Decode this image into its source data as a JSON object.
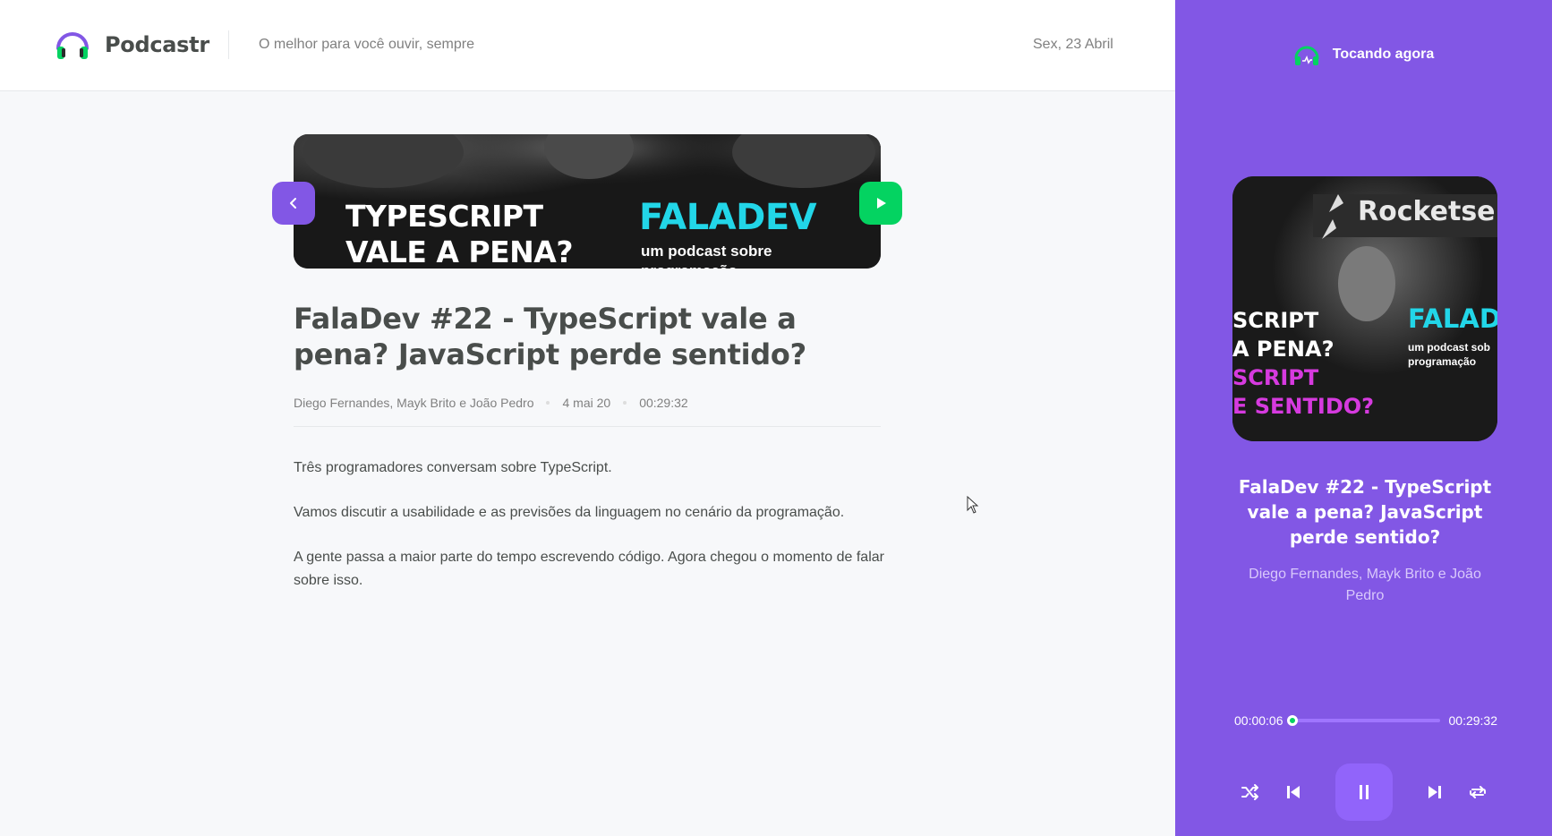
{
  "header": {
    "logo_text": "Podcastr",
    "tagline": "O melhor para você ouvir, sempre",
    "date": "Sex, 23 Abril"
  },
  "episode": {
    "cover_left_line1": "TYPESCRIPT",
    "cover_left_line2": "VALE A PENA?",
    "cover_right_title": "FALADEV",
    "cover_right_sub1": "um podcast sobre",
    "cover_right_sub2": "programação",
    "title": "FalaDev #22 - TypeScript vale a pena? JavaScript perde sentido?",
    "members": "Diego Fernandes, Mayk Brito e João Pedro",
    "published_at": "4 mai 20",
    "duration": "00:29:32",
    "description": [
      "Três programadores conversam sobre TypeScript.",
      "Vamos discutir a usabilidade e as previsões da linguagem no cenário da programação.",
      "A gente passa a maior parte do tempo escrevendo código. Agora chegou o momento de falar sobre isso."
    ]
  },
  "player": {
    "header_label": "Tocando agora",
    "cover_brand": "Rocketse",
    "cover_left_1": "SCRIPT",
    "cover_left_2": "A PENA?",
    "cover_left_3": "SCRIPT",
    "cover_left_4": "E SENTIDO?",
    "cover_right_title": "FALAD",
    "cover_right_sub1": "um podcast sob",
    "cover_right_sub2": "programação",
    "title": "FalaDev #22 - TypeScript vale a pena? JavaScript perde sentido?",
    "members": "Diego Fernandes, Mayk Brito e João Pedro",
    "current_time": "00:00:06",
    "total_time": "00:29:32",
    "progress_fraction": 0.0034
  },
  "icons": {
    "logo": "headphones-icon",
    "back": "chevron-left-icon",
    "play": "play-icon",
    "shuffle": "shuffle-icon",
    "previous": "play-previous-icon",
    "pause": "pause-icon",
    "next": "play-next-icon",
    "repeat": "repeat-icon"
  },
  "colors": {
    "brand_purple": "#8257e5",
    "accent_green": "#04d361",
    "cyan": "#22d6e8"
  }
}
